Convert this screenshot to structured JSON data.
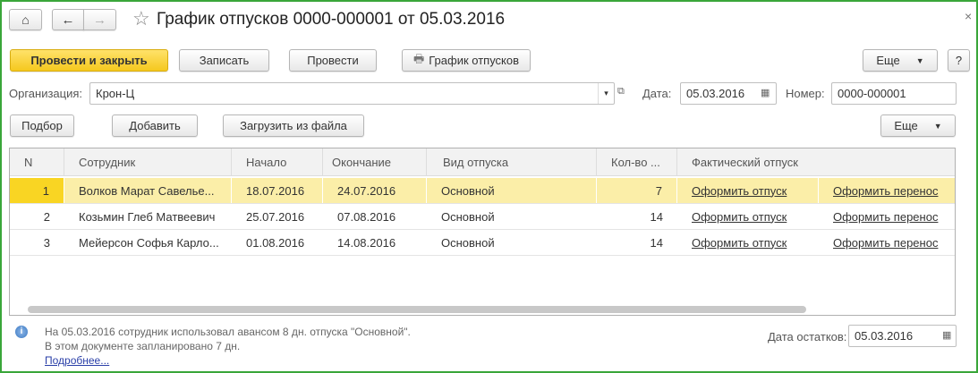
{
  "window": {
    "title": "График отпусков 0000-000001 от 05.03.2016",
    "close": "×"
  },
  "toolbar": {
    "post_close": "Провести и закрыть",
    "save": "Записать",
    "post": "Провести",
    "print": "График отпусков",
    "more": "Еще",
    "help": "?"
  },
  "header": {
    "org_label": "Организация:",
    "org_value": "Крон-Ц",
    "date_label": "Дата:",
    "date_value": "05.03.2016",
    "number_label": "Номер:",
    "number_value": "0000-000001"
  },
  "table_toolbar": {
    "select": "Подбор",
    "add": "Добавить",
    "load": "Загрузить из файла",
    "more": "Еще"
  },
  "table": {
    "columns": [
      "N",
      "Сотрудник",
      "Начало",
      "Окончание",
      "Вид отпуска",
      "Кол-во ...",
      "Фактический отпуск"
    ],
    "rows": [
      {
        "n": "1",
        "employee": "Волков Марат Савелье...",
        "start": "18.07.2016",
        "end": "24.07.2016",
        "type": "Основной",
        "days": "7",
        "action1": "Оформить отпуск",
        "action2": "Оформить перенос"
      },
      {
        "n": "2",
        "employee": "Козьмин Глеб Матвеевич",
        "start": "25.07.2016",
        "end": "07.08.2016",
        "type": "Основной",
        "days": "14",
        "action1": "Оформить отпуск",
        "action2": "Оформить перенос"
      },
      {
        "n": "3",
        "employee": "Мейерсон Софья Карло...",
        "start": "01.08.2016",
        "end": "14.08.2016",
        "type": "Основной",
        "days": "14",
        "action1": "Оформить отпуск",
        "action2": "Оформить перенос"
      }
    ]
  },
  "footer": {
    "info_line1": "На 05.03.2016 сотрудник использовал авансом 8 дн. отпуска \"Основной\".",
    "info_line2": "В этом документе запланировано 7 дн.",
    "more_link": "Подробнее...",
    "balance_label": "Дата остатков:",
    "balance_date": "05.03.2016"
  }
}
